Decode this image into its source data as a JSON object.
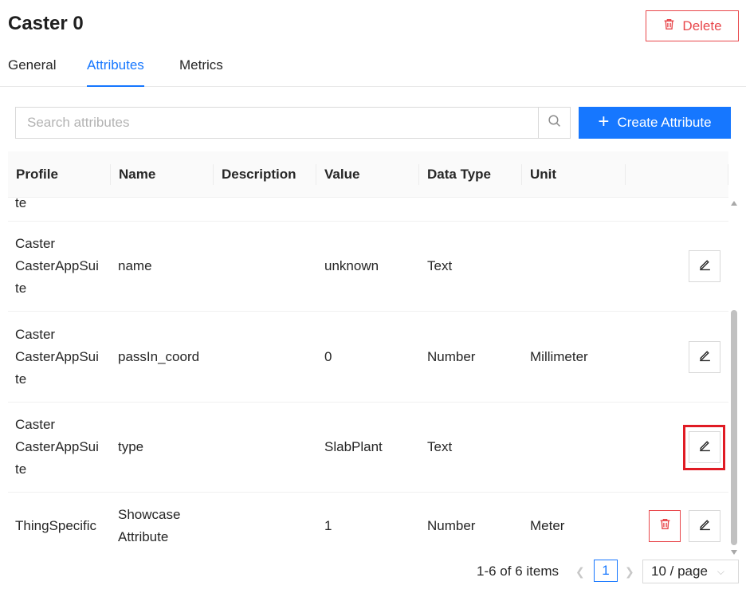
{
  "header": {
    "title": "Caster 0",
    "delete_label": "Delete"
  },
  "tabs": [
    {
      "label": "General",
      "active": false
    },
    {
      "label": "Attributes",
      "active": true
    },
    {
      "label": "Metrics",
      "active": false
    }
  ],
  "search": {
    "placeholder": "Search attributes",
    "value": ""
  },
  "create_button": {
    "label": "Create Attribute"
  },
  "table": {
    "columns": [
      "Profile",
      "Name",
      "Description",
      "Value",
      "Data Type",
      "Unit"
    ],
    "partial_row_text": "te",
    "rows": [
      {
        "profile_lines": [
          "Caster",
          "CasterAppSui",
          "te"
        ],
        "name_lines": [
          "name"
        ],
        "description": "",
        "value": "unknown",
        "data_type": "Text",
        "unit": ""
      },
      {
        "profile_lines": [
          "Caster",
          "CasterAppSui",
          "te"
        ],
        "name_lines": [
          "passIn_coord"
        ],
        "description": "",
        "value": "0",
        "data_type": "Number",
        "unit": "Millimeter"
      },
      {
        "profile_lines": [
          "Caster",
          "CasterAppSui",
          "te"
        ],
        "name_lines": [
          "type"
        ],
        "description": "",
        "value": "SlabPlant",
        "data_type": "Text",
        "unit": ""
      },
      {
        "profile_lines": [
          "ThingSpecific"
        ],
        "name_lines": [
          "Showcase",
          "Attribute"
        ],
        "description": "",
        "value": "1",
        "data_type": "Number",
        "unit": "Meter"
      }
    ]
  },
  "pagination": {
    "total_text": "1-6 of 6 items",
    "current_page": "1",
    "page_size": "10 / page"
  },
  "colors": {
    "accent": "#1677ff",
    "danger": "#e8474b",
    "highlight": "#e01b24"
  },
  "icons": [
    "trash-icon",
    "search-icon",
    "plus-icon",
    "edit-icon",
    "chevron-left-icon",
    "chevron-right-icon",
    "chevron-down-icon"
  ]
}
